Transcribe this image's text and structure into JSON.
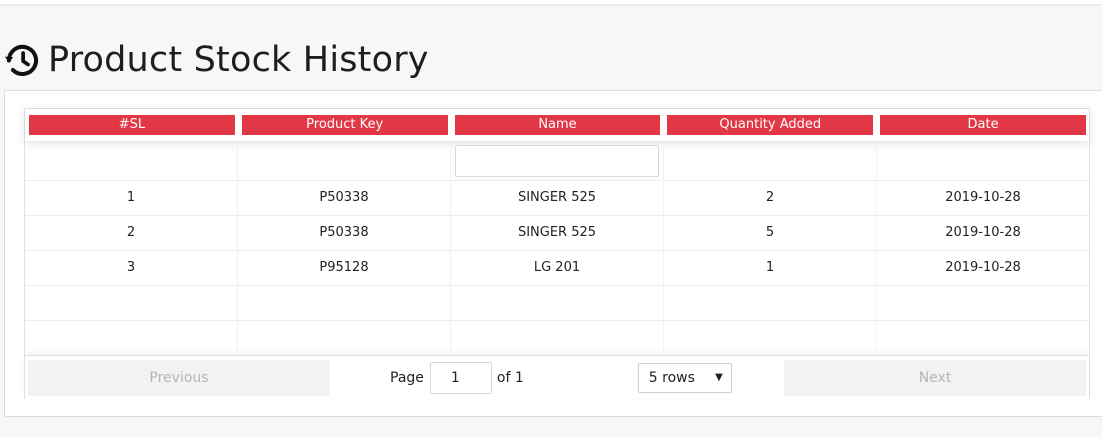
{
  "page": {
    "title": "Product Stock History",
    "icon": "history-icon"
  },
  "table": {
    "columns": [
      "#SL",
      "Product Key",
      "Name",
      "Quantity Added",
      "Date"
    ],
    "header_color": "#e23744",
    "rows": [
      [
        "1",
        "P50338",
        "SINGER 525",
        "2",
        "2019-10-28"
      ],
      [
        "2",
        "P50338",
        "SINGER 525",
        "5",
        "2019-10-28"
      ],
      [
        "3",
        "P95128",
        "LG 201",
        "1",
        "2019-10-28"
      ],
      [
        "",
        "",
        "",
        "",
        ""
      ],
      [
        "",
        "",
        "",
        "",
        ""
      ]
    ],
    "name_filter_value": ""
  },
  "pagination": {
    "previous_label": "Previous",
    "next_label": "Next",
    "page_label": "Page",
    "current_page": "1",
    "of_label": "of 1",
    "rows_option": "5 rows"
  }
}
